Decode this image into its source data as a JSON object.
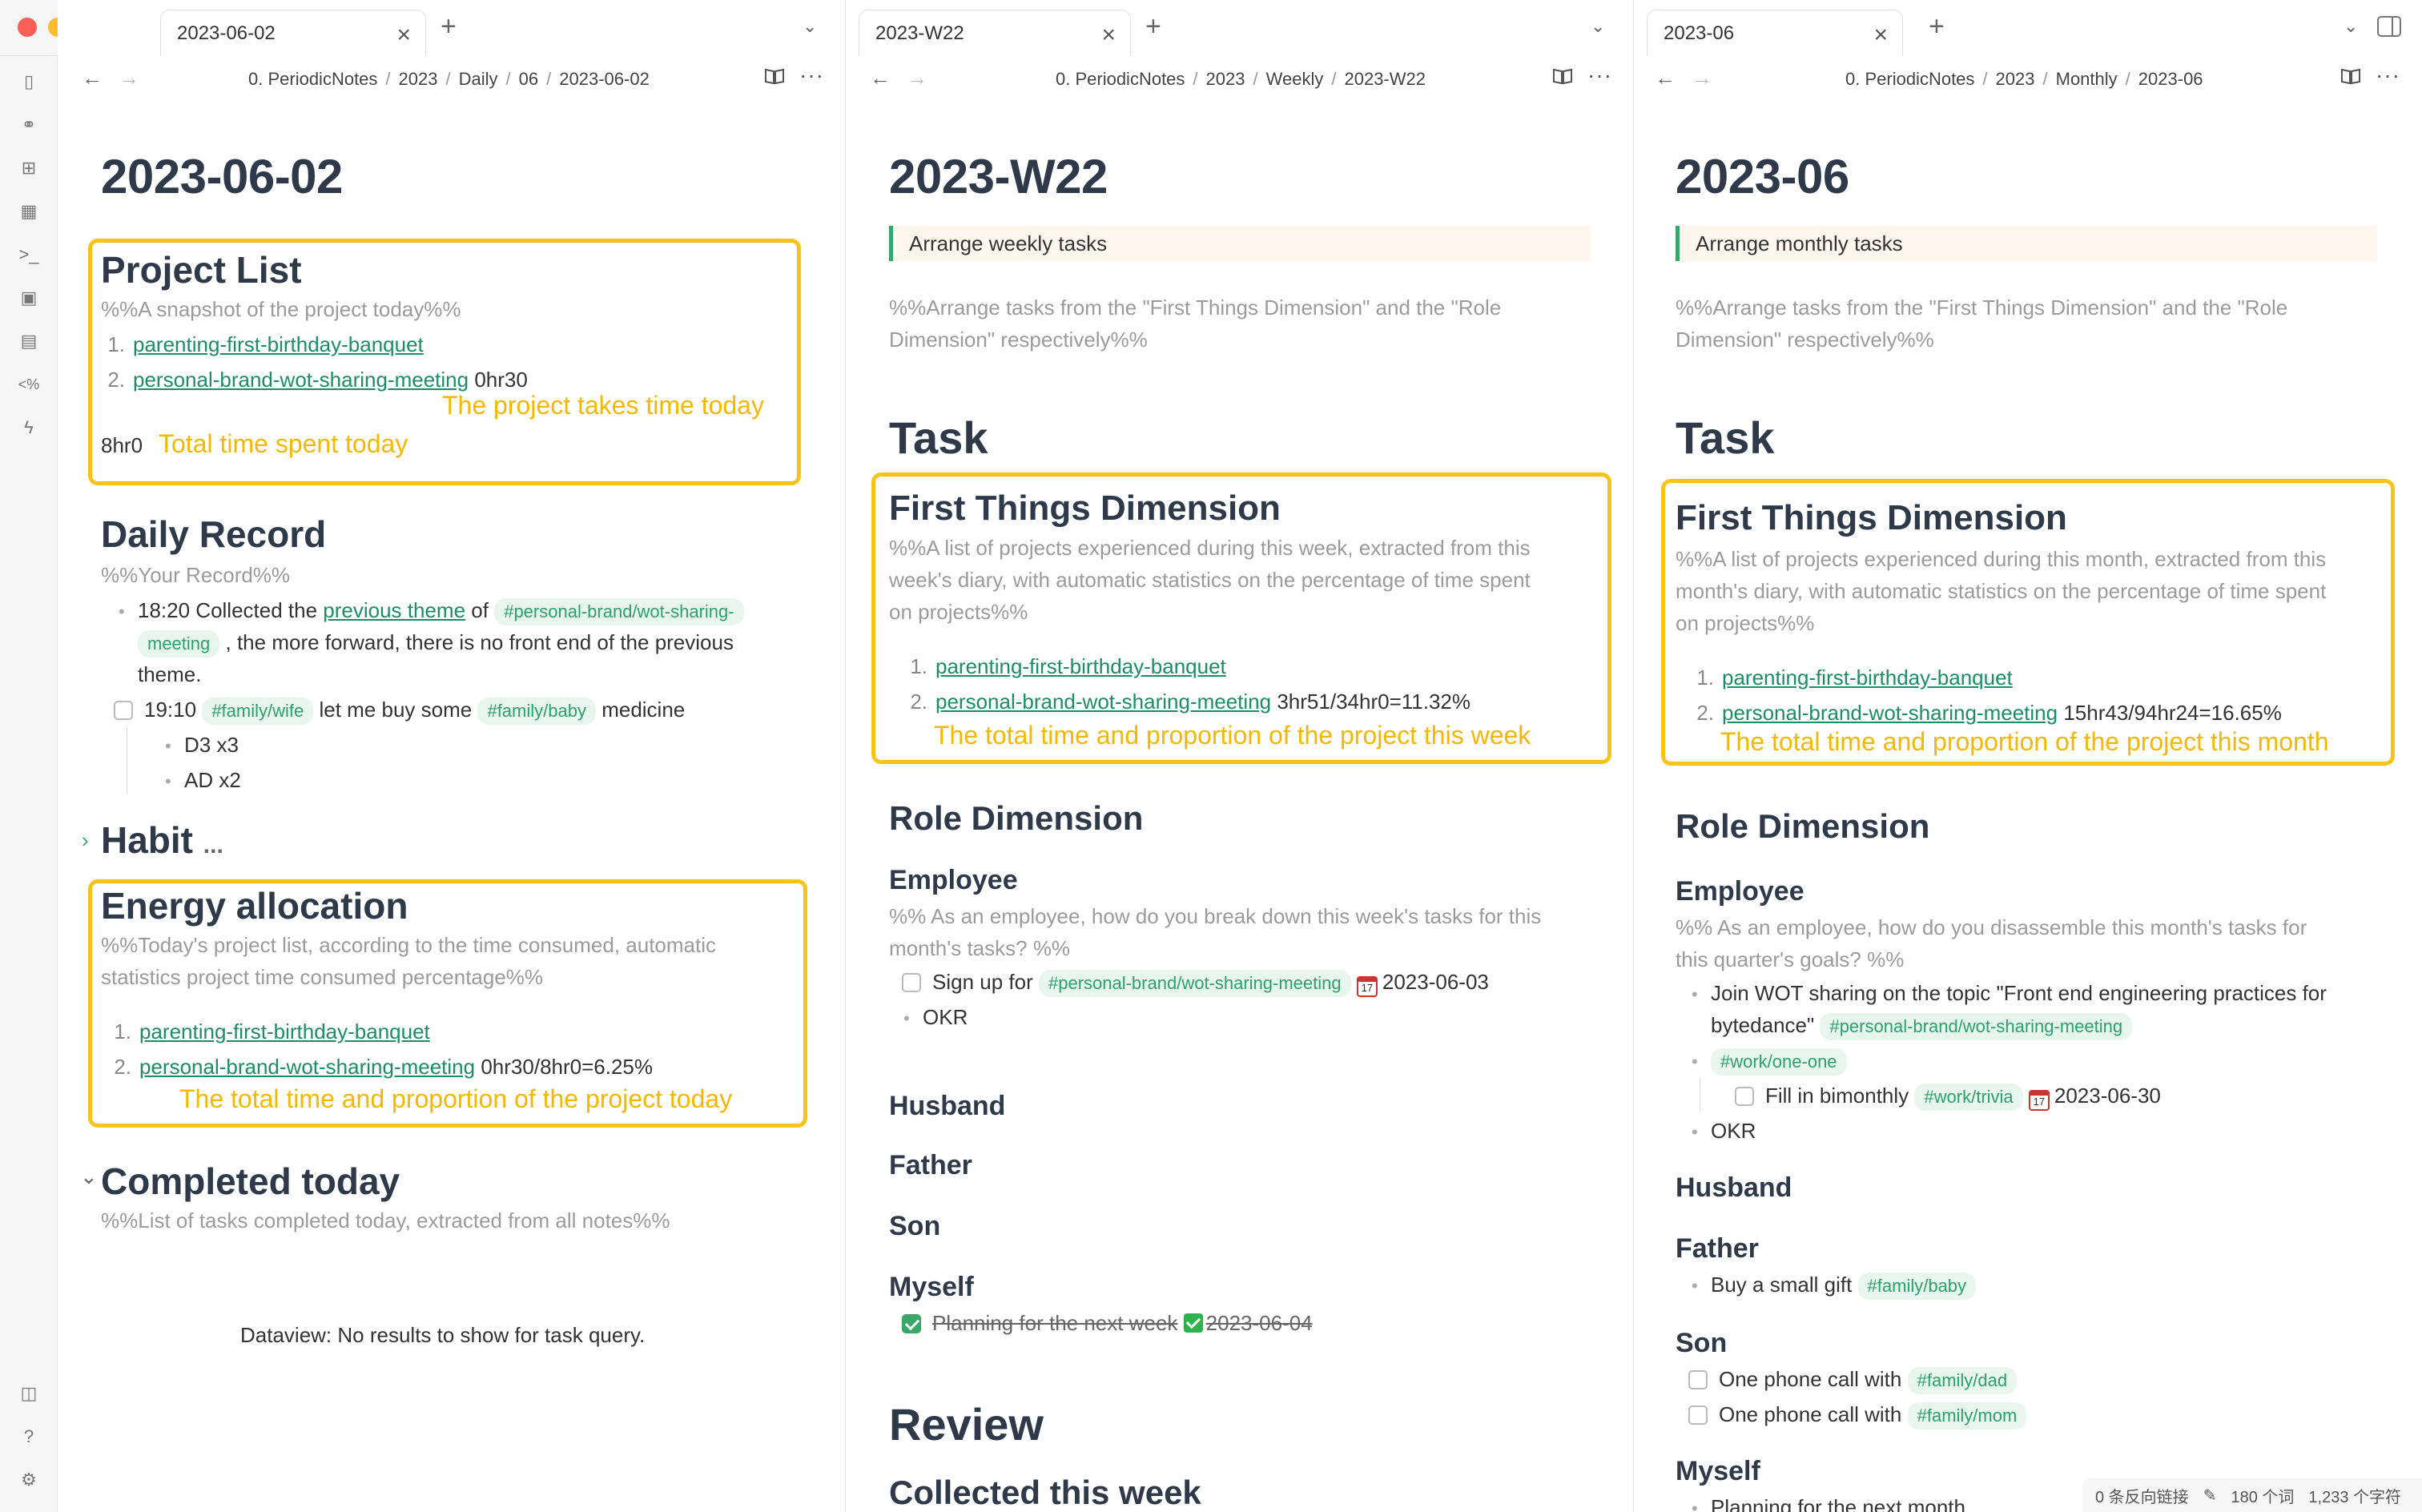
{
  "pane1": {
    "tab": "2023-06-02",
    "breadcrumb": [
      "0. PeriodicNotes",
      "2023",
      "Daily",
      "06",
      "2023-06-02"
    ],
    "title": "2023-06-02",
    "project_list": {
      "heading": "Project List",
      "comment": "%%A snapshot of the project today%%",
      "item1_link": "parenting-first-birthday-banquet",
      "item2_link": "personal-brand-wot-sharing-meeting",
      "item2_time": "0hr30",
      "total": "8hr0",
      "anno_project": "The project takes time today",
      "anno_total": "Total time spent today"
    },
    "daily_record": {
      "heading": "Daily Record",
      "comment": "%%Your Record%%",
      "r1_time": "18:20 Collected the",
      "r1_link": "previous theme",
      "r1_of": "of",
      "r1_tag_a": "#personal-brand/wot-sharing-",
      "r1_tag_b": "meeting",
      "r1_rest": ", the more forward, there is no front end of the previous",
      "r1_rest2": "theme.",
      "r2_time": "19:10",
      "r2_tag1": "#family/wife",
      "r2_mid": "let me buy some",
      "r2_tag2": "#family/baby",
      "r2_end": "medicine",
      "sub1": "D3 x3",
      "sub2": "AD x2"
    },
    "habit": {
      "heading": "Habit",
      "more": "..."
    },
    "energy": {
      "heading": "Energy allocation",
      "comment1": "%%Today's project list, according to the time consumed, automatic",
      "comment2": "statistics project time consumed percentage%%",
      "item1_link": "parenting-first-birthday-banquet",
      "item2_link": "personal-brand-wot-sharing-meeting",
      "item2_value": "0hr30/8hr0=6.25%",
      "anno": "The total time and proportion of the project today"
    },
    "completed": {
      "heading": "Completed today",
      "comment": "%%List of tasks completed today, extracted from all notes%%",
      "dataview": "Dataview: No results to show for task query."
    }
  },
  "pane2": {
    "tab": "2023-W22",
    "breadcrumb": [
      "0. PeriodicNotes",
      "2023",
      "Weekly",
      "2023-W22"
    ],
    "title": "2023-W22",
    "callout": "Arrange weekly tasks",
    "comment1": "%%Arrange tasks from the \"First Things Dimension\" and the \"Role",
    "comment2": "Dimension\" respectively%%",
    "task_heading": "Task",
    "first_things": {
      "heading": "First Things Dimension",
      "c1": "%%A list of projects experienced during this week, extracted from this",
      "c2": "week's diary, with automatic statistics on the percentage of time spent",
      "c3": "on projects%%",
      "item1_link": "parenting-first-birthday-banquet",
      "item2_link": "personal-brand-wot-sharing-meeting",
      "item2_value": "3hr51/34hr0=11.32%",
      "anno": "The total time and proportion of the project this week"
    },
    "role": {
      "heading": "Role Dimension",
      "employee": "Employee",
      "emp_c1": "%% As an employee, how do you break down this week's tasks for this",
      "emp_c2": "month's tasks? %%",
      "task1_text": "Sign up for",
      "task1_tag": "#personal-brand/wot-sharing-meeting",
      "task1_date": "2023-06-03",
      "okr": "OKR",
      "husband": "Husband",
      "father": "Father",
      "son": "Son",
      "myself": "Myself",
      "myself_task": "Planning for the next week",
      "myself_date": "2023-06-04"
    },
    "review": "Review",
    "collected": "Collected this week"
  },
  "pane3": {
    "tab": "2023-06",
    "breadcrumb": [
      "0. PeriodicNotes",
      "2023",
      "Monthly",
      "2023-06"
    ],
    "title": "2023-06",
    "callout": "Arrange monthly tasks",
    "comment1": "%%Arrange tasks from the \"First Things Dimension\" and the \"Role",
    "comment2": "Dimension\" respectively%%",
    "task_heading": "Task",
    "first_things": {
      "heading": "First Things Dimension",
      "c1": "%%A list of projects experienced during this month, extracted from this",
      "c2": "month's diary, with automatic statistics on the percentage of time spent",
      "c3": "on projects%%",
      "item1_link": "parenting-first-birthday-banquet",
      "item2_link": "personal-brand-wot-sharing-meeting",
      "item2_value": "15hr43/94hr24=16.65%",
      "anno": "The total time and proportion of the project this month"
    },
    "role": {
      "heading": "Role Dimension",
      "employee": "Employee",
      "emp_c1": "%% As an employee, how do you disassemble this month's tasks for",
      "emp_c2": "this quarter's goals? %%",
      "b1_a": "Join WOT sharing on the topic \"Front end engineering practices for",
      "b1_b": "bytedance\"",
      "b1_tag": "#personal-brand/wot-sharing-meeting",
      "b2_tag": "#work/one-one",
      "sub_task": "Fill in bimonthly",
      "sub_tag": "#work/trivia",
      "sub_date": "2023-06-30",
      "okr": "OKR",
      "husband": "Husband",
      "father": "Father",
      "father_item": "Buy a small gift",
      "father_tag": "#family/baby",
      "son": "Son",
      "son_t1": "One phone call with",
      "son_t1_tag": "#family/dad",
      "son_t2": "One phone call with",
      "son_t2_tag": "#family/mom",
      "myself": "Myself",
      "myself_item": "Planning for the next month"
    }
  },
  "statusbar": {
    "backlinks": "0 条反向链接",
    "words": "180 个词",
    "chars": "1,233 个字符"
  },
  "colors": {
    "highlight": "#f9c417",
    "annotation": "#f5b800",
    "link": "#1d8d63",
    "tag_bg": "#e9f6ee",
    "heading": "#2e3a4a"
  },
  "ribbon_icons": [
    "file-plus-icon",
    "graph-icon",
    "canvas-icon",
    "calendar-icon",
    "terminal-icon",
    "image-icon",
    "layout-icon",
    "code-icon",
    "lightning-icon",
    "vault-icon",
    "help-icon",
    "settings-icon"
  ]
}
